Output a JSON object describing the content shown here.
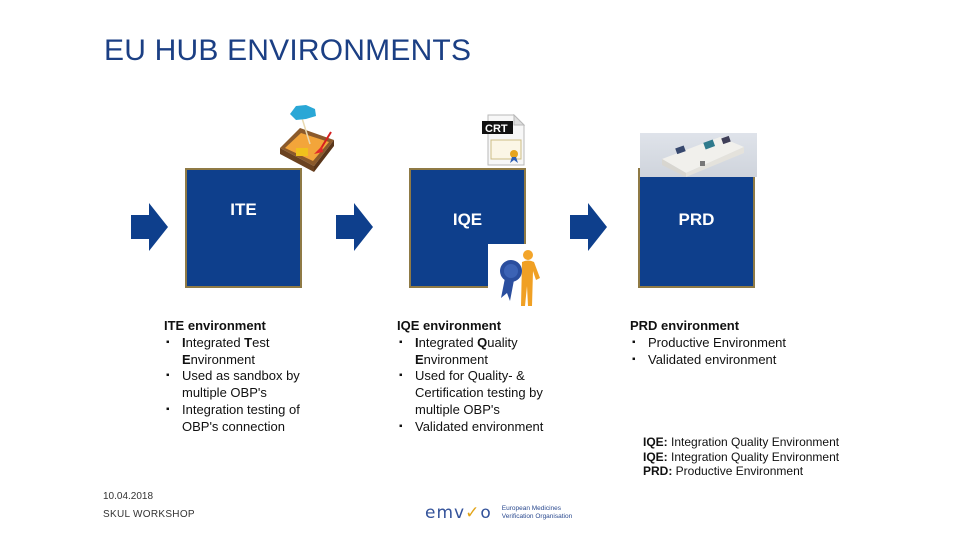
{
  "slide": {
    "title": "EU HUB ENVIRONMENTS",
    "colors": {
      "box_fill": "#0e3f8c",
      "box_border": "#8f7a45",
      "title": "#1b3f84",
      "arrow": "#0e3f8c"
    }
  },
  "environments": [
    {
      "label": "ITE",
      "image": "sandbox-icon",
      "heading": "ITE environment",
      "bullets": [
        {
          "parts": [
            {
              "t": "I",
              "b": true
            },
            {
              "t": "ntegrated ",
              "b": false
            },
            {
              "t": "T",
              "b": true
            },
            {
              "t": "est ",
              "b": false
            },
            {
              "t": "E",
              "b": true
            },
            {
              "t": "nvironment",
              "b": false
            }
          ]
        },
        {
          "parts": [
            {
              "t": "Used as sandbox by multiple OBP's",
              "b": false
            }
          ]
        },
        {
          "parts": [
            {
              "t": "Integration testing of OBP's connection",
              "b": false
            }
          ]
        }
      ]
    },
    {
      "label": "IQE",
      "image": "certificate-icon",
      "image2": "award-person-icon",
      "cert_label": "CRT",
      "heading": "IQE environment",
      "bullets": [
        {
          "parts": [
            {
              "t": "I",
              "b": true
            },
            {
              "t": "ntegrated ",
              "b": false
            },
            {
              "t": "Q",
              "b": true
            },
            {
              "t": "uality ",
              "b": false
            },
            {
              "t": "E",
              "b": true
            },
            {
              "t": "nvironment",
              "b": false
            }
          ]
        },
        {
          "parts": [
            {
              "t": "Used for Quality- & Certification testing by multiple OBP's",
              "b": false
            }
          ]
        },
        {
          "parts": [
            {
              "t": "Validated environment",
              "b": false
            }
          ]
        }
      ]
    },
    {
      "label": "PRD",
      "image": "medicine-box-photo",
      "heading": "PRD environment",
      "bullets": [
        {
          "parts": [
            {
              "t": "Productive Environment",
              "b": false
            }
          ]
        },
        {
          "parts": [
            {
              "t": "Validated environment",
              "b": false
            }
          ]
        }
      ]
    }
  ],
  "legend": [
    {
      "abbr": "IQE:",
      "text": " Integration Quality Environment"
    },
    {
      "abbr": "IQE:",
      "text": " Integration Quality Environment"
    },
    {
      "abbr": "PRD:",
      "text": " Productive Environment"
    }
  ],
  "footer": {
    "date": "10.04.2018",
    "event": "SKUL WORKSHOP",
    "logo_mark_a": "emv",
    "logo_mark_b": "o",
    "logo_text_line1": "European Medicines",
    "logo_text_line2": "Verification Organisation"
  }
}
